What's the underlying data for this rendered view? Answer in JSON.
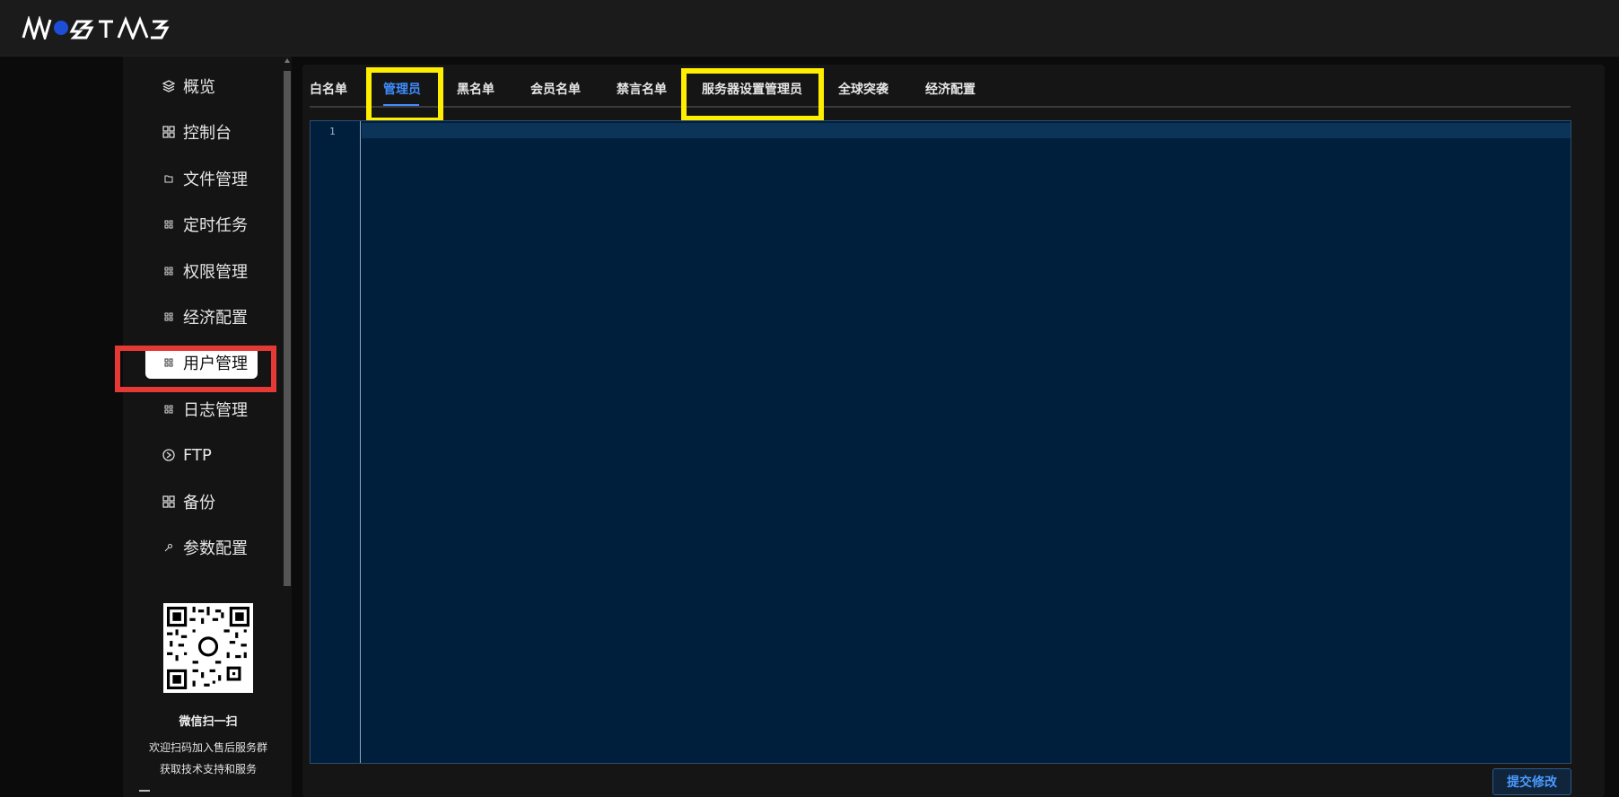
{
  "header": {
    "logo_text": "WOSTNS"
  },
  "sidebar": {
    "items": [
      {
        "label": "概览",
        "icon": "layers-icon"
      },
      {
        "label": "控制台",
        "icon": "grid-icon"
      },
      {
        "label": "文件管理",
        "icon": "folder-icon"
      },
      {
        "label": "定时任务",
        "icon": "grid-icon"
      },
      {
        "label": "权限管理",
        "icon": "grid-icon"
      },
      {
        "label": "经济配置",
        "icon": "grid-icon"
      },
      {
        "label": "用户管理",
        "icon": "grid-icon"
      },
      {
        "label": "日志管理",
        "icon": "grid-icon"
      },
      {
        "label": "FTP",
        "icon": "ftp-icon"
      },
      {
        "label": "备份",
        "icon": "grid-icon"
      },
      {
        "label": "参数配置",
        "icon": "key-icon"
      }
    ],
    "qr_title": "微信扫一扫",
    "qr_line1": "欢迎扫码加入售后服务群",
    "qr_line2": "获取技术支持和服务"
  },
  "tabs": [
    {
      "label": "白名单"
    },
    {
      "label": "管理员"
    },
    {
      "label": "黑名单"
    },
    {
      "label": "会员名单"
    },
    {
      "label": "禁言名单"
    },
    {
      "label": "服务器设置管理员"
    },
    {
      "label": "全球突袭"
    },
    {
      "label": "经济配置"
    }
  ],
  "active_tab": "管理员",
  "active_menu": "用户管理",
  "editor": {
    "line_number": "1"
  },
  "submit_label": "提交修改",
  "colors": {
    "accent": "#3f8cff",
    "editor_bg": "#001f3d",
    "highlight_red": "#e53935",
    "highlight_yellow": "#ffee00"
  }
}
